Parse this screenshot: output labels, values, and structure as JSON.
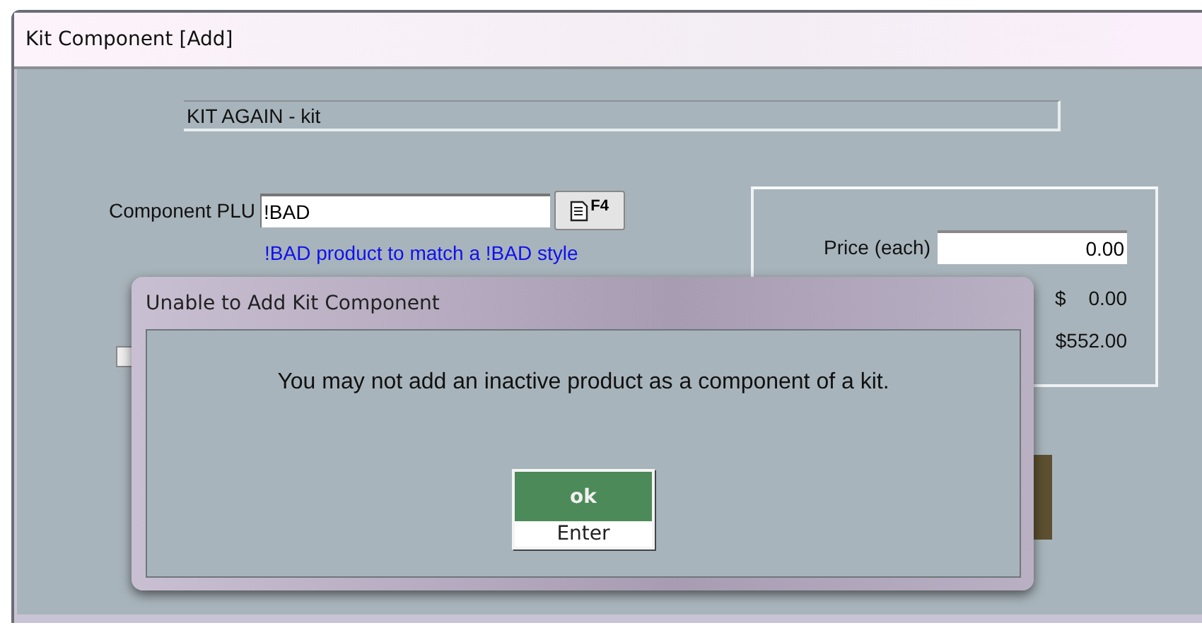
{
  "window": {
    "title": "Kit Component  [Add]"
  },
  "kit_name": "KIT AGAIN - kit",
  "component_plu": {
    "label": "Component PLU",
    "value": "!BAD",
    "lookup_key": "F4"
  },
  "hint": "!BAD product to match a !BAD style",
  "option_checkbox": {
    "checked": false
  },
  "pricing": {
    "price_label": "Price (each)",
    "price_value": "0.00",
    "currency_symbol": "$",
    "amount": "0.00",
    "total": "$552.00"
  },
  "dialog": {
    "title": "Unable to Add Kit Component",
    "message": "You may not add an inactive product as a component of a kit.",
    "buttons": [
      {
        "label": "ok",
        "shortcut": "Enter"
      }
    ]
  }
}
